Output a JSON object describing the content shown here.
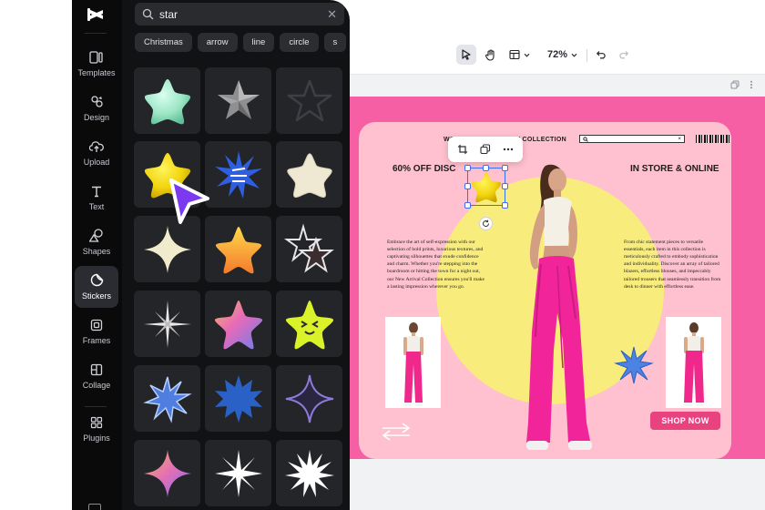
{
  "app": {
    "logo": "capcut-logo-icon"
  },
  "rail": {
    "items": [
      {
        "label": "Templates",
        "icon": "templates-icon"
      },
      {
        "label": "Design",
        "icon": "design-icon"
      },
      {
        "label": "Upload",
        "icon": "upload-icon"
      },
      {
        "label": "Text",
        "icon": "text-icon"
      },
      {
        "label": "Shapes",
        "icon": "shapes-icon"
      },
      {
        "label": "Stickers",
        "icon": "stickers-icon",
        "active": true
      },
      {
        "label": "Frames",
        "icon": "frames-icon"
      },
      {
        "label": "Collage",
        "icon": "collage-icon"
      },
      {
        "label": "Plugins",
        "icon": "plugins-icon"
      }
    ]
  },
  "search": {
    "value": "star",
    "clear_icon": "close-icon"
  },
  "chips": [
    "Christmas",
    "arrow",
    "line",
    "circle",
    "s"
  ],
  "stickers": [
    {
      "name": "mint-puffy-star-sticker",
      "color": "#9ee6c6"
    },
    {
      "name": "silver-metal-star-sticker",
      "color": "#9a9a9a"
    },
    {
      "name": "dark-outline-star-sticker",
      "color": "#3a3b3f"
    },
    {
      "name": "yellow-puffy-star-sticker",
      "color": "#f2d71e"
    },
    {
      "name": "blue-zigzag-burst-sticker",
      "color": "#2f5fe0"
    },
    {
      "name": "cream-puffy-star-sticker",
      "color": "#efe8d2"
    },
    {
      "name": "cream-four-point-star-sticker",
      "color": "#f1ebcd"
    },
    {
      "name": "orange-gradient-star-sticker",
      "color": "#f7a33a"
    },
    {
      "name": "double-star-outline-sticker",
      "color": "#e9e9ea"
    },
    {
      "name": "white-thin-sparkle-sticker",
      "color": "#e8e8e8"
    },
    {
      "name": "holographic-star-sticker",
      "color": "#e77ab9"
    },
    {
      "name": "lime-winking-star-sticker",
      "color": "#d9f22a"
    },
    {
      "name": "blue-burst-outline-sticker",
      "color": "#4d7ee0"
    },
    {
      "name": "blue-starburst-sticker",
      "color": "#2a61c7"
    },
    {
      "name": "purple-four-point-star-sticker",
      "color": "#8e7ad9"
    },
    {
      "name": "gradient-four-point-sparkle-sticker",
      "color": "#e78aa6"
    },
    {
      "name": "white-eight-point-sparkle-sticker",
      "color": "#ffffff"
    },
    {
      "name": "white-starburst-sticker",
      "color": "#ffffff"
    }
  ],
  "editor": {
    "zoom": "72%",
    "tools": [
      "select-icon",
      "hand-icon",
      "layout-icon",
      "undo-icon",
      "redo-icon"
    ]
  },
  "design": {
    "nav_women": "WOMEN",
    "nav_collection": "NEW COLLECTION",
    "search_close": "×",
    "headline_left": "60% OFF DISC",
    "headline_right": "IN STORE & ONLINE",
    "copy_left": "Embrace the art of self-expression with our selection of bold prints, luxurious textures, and captivating silhouettes that exude confidence and charm. Whether you're stepping into the boardroom or hitting the town for a night out, our New Arrival Collection ensures you'll make a lasting impression wherever you go.",
    "copy_right": "From chic statement pieces to versatile essentials, each item in this collection is meticulously crafted to embody sophistication and individuality. Discover an array of tailored blazers, effortless blouses, and impeccably tailored trousers that seamlessly transition from desk to dinner with effortless ease.",
    "cta": "SHOP NOW",
    "accent": "#f65fa3",
    "card_color": "#ffc0cf",
    "circle_color": "#f8ed7c",
    "cta_color": "#e8427f"
  }
}
